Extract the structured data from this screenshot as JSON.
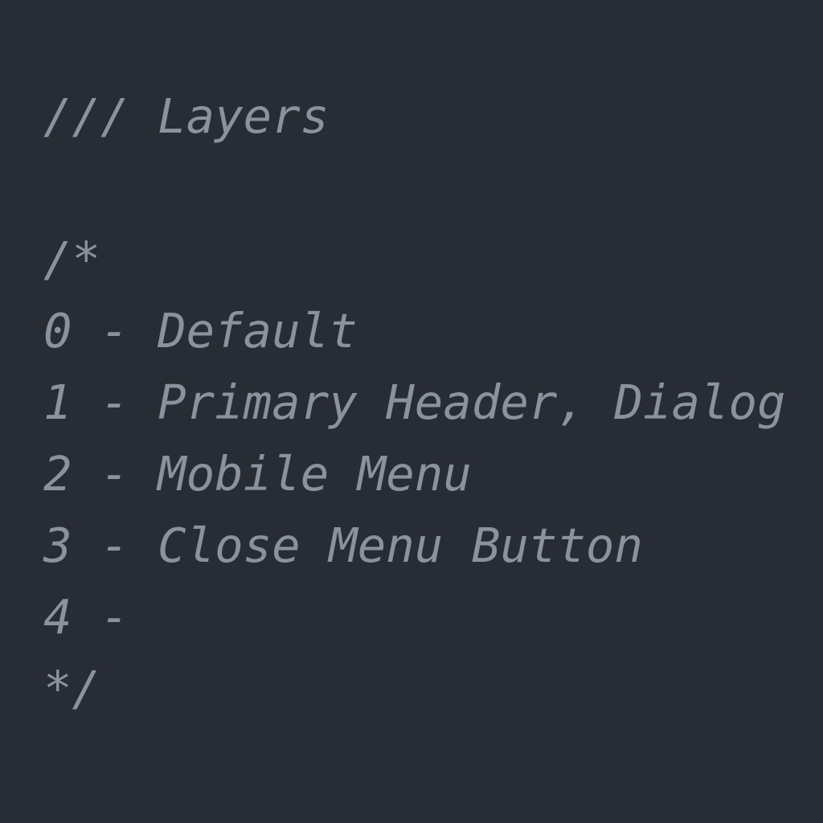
{
  "editor": {
    "lines": [
      "/// Layers",
      "",
      "/*",
      "0 - Default",
      "1 - Primary Header, Dialog",
      "2 - Mobile Menu",
      "3 - Close Menu Button",
      "4 -",
      "*/"
    ]
  },
  "colors": {
    "background": "#282c34",
    "comment": "#8b929c"
  }
}
